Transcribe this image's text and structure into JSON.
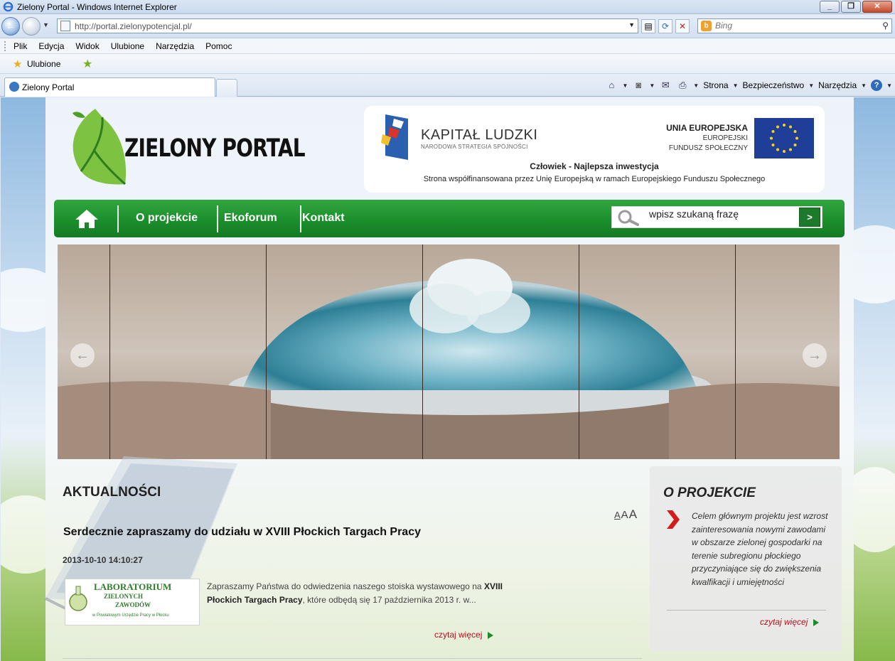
{
  "window": {
    "title": "Zielony Portal - Windows Internet Explorer"
  },
  "address_bar": {
    "url": "http://portal.zielonypotencjal.pl/",
    "search_placeholder": "Bing"
  },
  "menu": {
    "items": [
      "Plik",
      "Edycja",
      "Widok",
      "Ulubione",
      "Narzędzia",
      "Pomoc"
    ]
  },
  "favorites_bar": {
    "label": "Ulubione"
  },
  "tabs": [
    {
      "label": "Zielony Portal"
    }
  ],
  "command_bar": {
    "page_label": "Strona",
    "safety_label": "Bezpieczeństwo",
    "tools_label": "Narzędzia"
  },
  "site": {
    "brand": "ZIELONY PORTAL",
    "eu_banner": {
      "kl_title": "KAPITAŁ LUDZKI",
      "kl_subtitle": "NARODOWA STRATEGIA SPÓJNOŚCI",
      "ue_title": "UNIA EUROPEJSKA",
      "ue_sub1": "EUROPEJSKI",
      "ue_sub2": "FUNDUSZ SPOŁECZNY",
      "motto": "Człowiek - Najlepsza inwestycja",
      "note": "Strona współfinansowana przez Unię Europejską w ramach Europejskiego Funduszu Społecznego"
    },
    "nav": {
      "items": [
        "O projekcie",
        "Ekoforum",
        "Kontakt"
      ],
      "search_value": "wpisz szukaną frazę",
      "search_button": ">"
    },
    "slider": {
      "prev_glyph": "←",
      "next_glyph": "→"
    },
    "news": {
      "section_title": "AKTUALNOŚCI",
      "font_sizes": [
        "A",
        "A",
        "A"
      ],
      "article": {
        "title": "Serdecznie zapraszamy do udziału w XVIII Płockich Targach Pracy",
        "date": "2013-10-10 14:10:27",
        "thumb_title_l1": "LABORATORIUM",
        "thumb_title_l2": "ZIELONYCH",
        "thumb_title_l3": "ZAWODÓW",
        "thumb_caption": "w Powiatowym Urzędzie Pracy w Płocku",
        "text_before": "Zapraszamy Państwa do odwiedzenia naszego stoiska wystawowego na ",
        "text_bold": "XVIII Płockich Targach Pracy",
        "text_after": ", które odbędą się 17 października 2013 r. w...",
        "read_more": "czytaj więcej"
      }
    },
    "about": {
      "section_title": "O PROJEKCIE",
      "text": "Celem głównym projektu jest wzrost zainteresowania nowymi zawodami w obszarze zielonej gospodarki na terenie subregionu płockiego przyczyniające się do zwiększenia kwalfikacji i umiejętności",
      "read_more": "czytaj więcej"
    }
  }
}
